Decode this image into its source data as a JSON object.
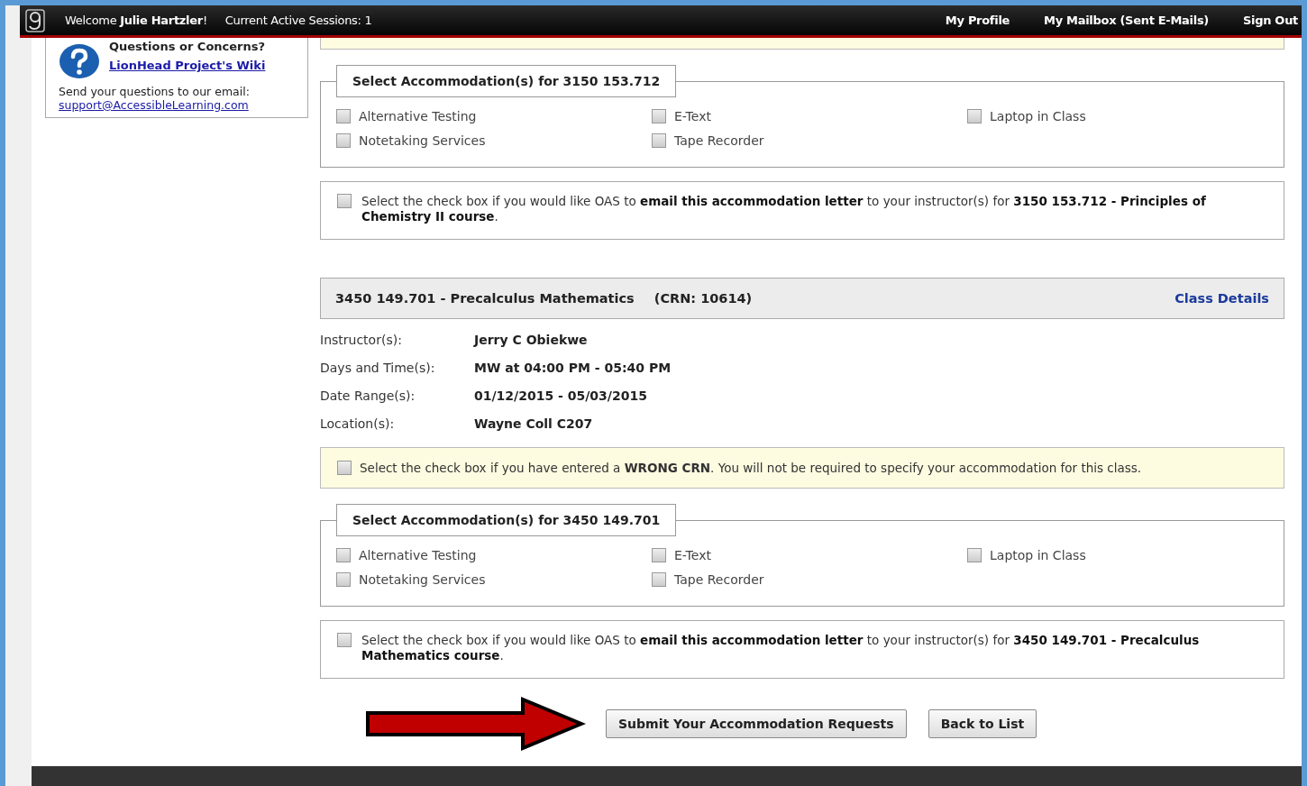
{
  "top_bar": {
    "welcome": "Welcome **Julie Hartzler**!",
    "sessions": "Current Active Sessions: 1",
    "links": [
      "My Profile",
      "My Mailbox (Sent E-Mails)",
      "Sign Out"
    ]
  },
  "sidebar": {
    "title": "Questions or Concerns?",
    "wiki_link": "LionHead Project's Wiki",
    "email_prompt": "Send your questions to our email:",
    "email": "support@AccessibleLearning.com"
  },
  "courses": [
    {
      "accommodations": {
        "legend": "Select Accommodation(s) for 3150 153.712",
        "options": [
          {
            "label": "Alternative Testing",
            "checked": false
          },
          {
            "label": "E-Text",
            "checked": false
          },
          {
            "label": "Laptop in Class",
            "checked": false
          },
          {
            "label": "Notetaking Services",
            "checked": false
          },
          {
            "label": "Tape Recorder",
            "checked": false
          }
        ]
      },
      "email_letter": {
        "checked": false,
        "text": "Select the check box if you would like OAS to **email this accommodation letter** to your instructor(s) for **3150 153.712 - Principles of Chemistry II course**."
      }
    },
    {
      "header": {
        "title": "3450 149.701 - Precalculus Mathematics",
        "crn": "(CRN: 10614)",
        "link": "Class Details"
      },
      "details": [
        {
          "label": "Instructor(s):",
          "value": "Jerry C Obiekwe"
        },
        {
          "label": "Days and Time(s):",
          "value": "MW at 04:00 PM - 05:40 PM"
        },
        {
          "label": "Date Range(s):",
          "value": "01/12/2015 - 05/03/2015"
        },
        {
          "label": "Location(s):",
          "value": "Wayne Coll C207"
        }
      ],
      "wrong_crn": {
        "checked": false,
        "text": "Select the check box if you have entered a **WRONG CRN**. You will not be required to specify your accommodation for this class."
      },
      "accommodations": {
        "legend": "Select Accommodation(s) for 3450 149.701",
        "options": [
          {
            "label": "Alternative Testing",
            "checked": false
          },
          {
            "label": "E-Text",
            "checked": false
          },
          {
            "label": "Laptop in Class",
            "checked": false
          },
          {
            "label": "Notetaking Services",
            "checked": false
          },
          {
            "label": "Tape Recorder",
            "checked": false
          }
        ]
      },
      "email_letter": {
        "checked": false,
        "text": "Select the check box if you would like OAS to **email this accommodation letter** to your instructor(s) for **3450 149.701 - Precalculus Mathematics course**."
      }
    }
  ],
  "buttons": [
    "Submit Your Accommodation Requests",
    "Back to List"
  ]
}
